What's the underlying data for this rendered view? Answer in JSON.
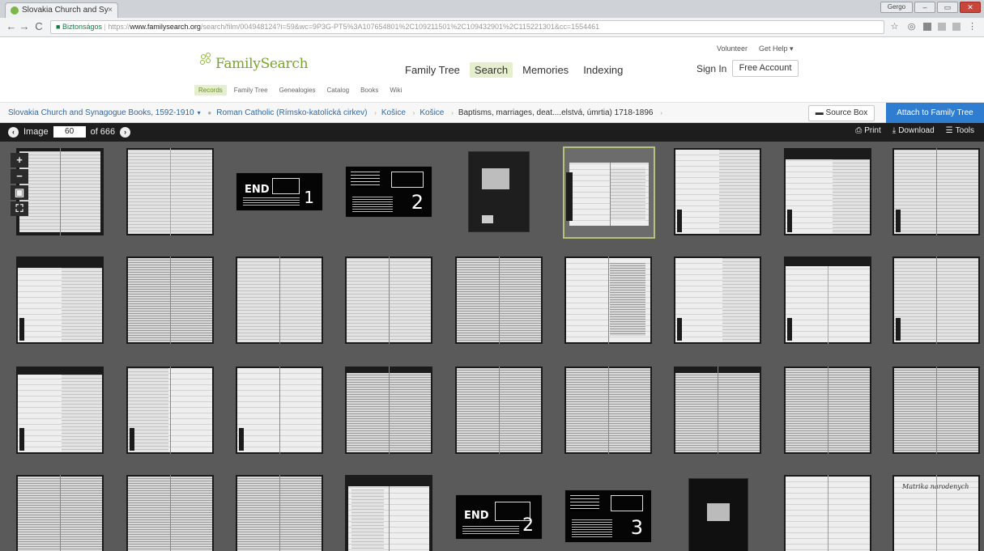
{
  "browser": {
    "tab_title": "Slovakia Church and Sy",
    "tab_close": "×",
    "back": "←",
    "forward": "→",
    "reload": "C",
    "secure_label": "Biztonságos",
    "url_prefix": "https://",
    "url_host": "www.familysearch.org",
    "url_path": "/search/film/004948124?i=59&wc=9P3G-PT5%3A107654801%2C109211501%2C109432901%2C115221301&cc=1554461",
    "star": "☆",
    "user_label": "Gergo"
  },
  "site": {
    "logo_text": "FamilySearch",
    "top_links": [
      "Volunteer",
      "Get Help ▾"
    ],
    "main_nav": [
      "Family Tree",
      "Search",
      "Memories",
      "Indexing"
    ],
    "main_nav_active": "Search",
    "sign_in": "Sign In",
    "free_account": "Free Account",
    "sub_nav": [
      "Records",
      "Family Tree",
      "Genealogies",
      "Catalog",
      "Books",
      "Wiki"
    ],
    "sub_nav_active": "Records"
  },
  "breadcrumb": {
    "collection": "Slovakia Church and Synagogue Books, 1592-1910",
    "dropdown": "▾",
    "items": [
      "Roman Catholic (Rímsko-katolícká cirkev)",
      "Košice",
      "Košice"
    ],
    "current": "Baptisms, marriages, deat....elstvá, úmrtia) 1718-1896",
    "source_box": "Source Box",
    "attach": "Attach to Family Tree"
  },
  "viewer": {
    "image_label": "Image",
    "image_number": "60",
    "of_label": "of 666",
    "prev": "‹",
    "next": "›",
    "print": "Print",
    "download": "Download",
    "tools": "Tools",
    "zoom_in": "+",
    "zoom_out": "−"
  },
  "targets": {
    "end_label": "END",
    "numbers": [
      "1",
      "2",
      "2",
      "3"
    ]
  },
  "handwriting": "Matrika narodenych"
}
